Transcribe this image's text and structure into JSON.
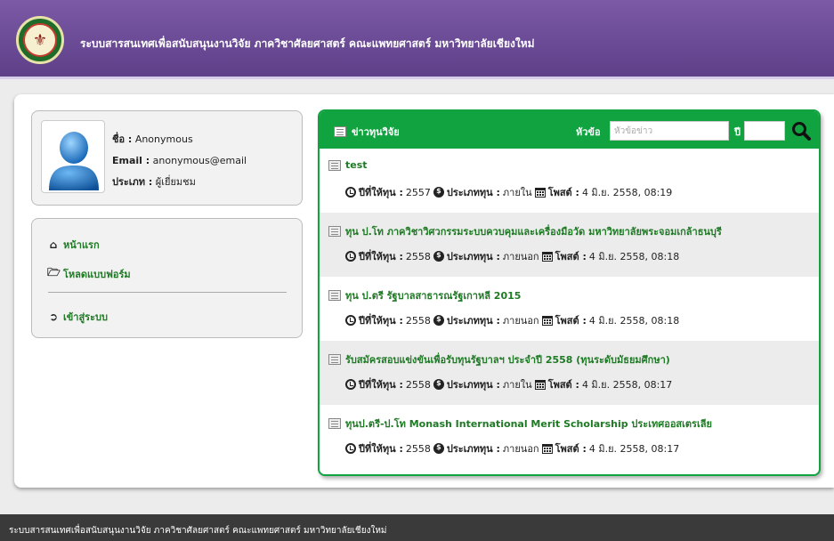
{
  "header": {
    "title": "ระบบสารสนเทศเพื่อสนับสนุนงานวิจัย ภาควิชาศัลยศาสตร์ คณะแพทยศาสตร์ มหาวิทยาลัยเชียงใหม่",
    "logo_icon": "university-seal-icon",
    "bg_color": "#6b4a96"
  },
  "profile": {
    "name_label": "ชื่อ :",
    "name_value": "Anonymous",
    "email_label": "Email :",
    "email_value": "anonymous@email",
    "type_label": "ประเภท :",
    "type_value": "ผู้เยี่ยมชม",
    "avatar_icon": "user-avatar-icon"
  },
  "nav": {
    "items": [
      {
        "label": "หน้าแรก",
        "icon": "home-icon"
      },
      {
        "label": "โหลดแบบฟอร์ม",
        "icon": "folder-open-icon"
      },
      {
        "label": "เข้าสู่ระบบ",
        "icon": "login-icon"
      }
    ]
  },
  "news": {
    "title": "ข่าวทุนวิจัย",
    "search_label": "หัวข้อ",
    "search_placeholder": "หัวข้อข่าว",
    "year_label": "ปี",
    "search_icon": "search-icon",
    "accent_color": "#10a340",
    "meta_labels": {
      "year": "ปีที่ให้ทุน :",
      "type": "ประเภททุน :",
      "posted": "โพสต์ :"
    },
    "items": [
      {
        "title": "test",
        "year": "2557",
        "type": "ภายใน",
        "posted": "4 มิ.ย. 2558, 08:19"
      },
      {
        "title": "ทุน ป.โท ภาควิชาวิศวกรรมระบบควบคุมและเครื่องมือวัด มหาวิทยาลัยพระจอมเกล้าธนบุรี",
        "year": "2558",
        "type": "ภายนอก",
        "posted": "4 มิ.ย. 2558, 08:18"
      },
      {
        "title": "ทุน ป.ตรี รัฐบาลสาธารณรัฐเกาหลี 2015",
        "year": "2558",
        "type": "ภายนอก",
        "posted": "4 มิ.ย. 2558, 08:18"
      },
      {
        "title": "รับสมัครสอบแข่งขันเพื่อรับทุนรัฐบาลฯ ประจำปี 2558 (ทุนระดับมัธยมศึกษา)",
        "year": "2558",
        "type": "ภายใน",
        "posted": "4 มิ.ย. 2558, 08:17"
      },
      {
        "title": "ทุนป.ตรี-ป.โท Monash International Merit Scholarship ประเทศออสเตรเลีย",
        "year": "2558",
        "type": "ภายนอก",
        "posted": "4 มิ.ย. 2558, 08:17"
      }
    ]
  },
  "footer": {
    "text": "ระบบสารสนเทศเพื่อสนับสนุนงานวิจัย ภาควิชาศัลยศาสตร์ คณะแพทยศาสตร์ มหาวิทยาลัยเชียงใหม่"
  }
}
